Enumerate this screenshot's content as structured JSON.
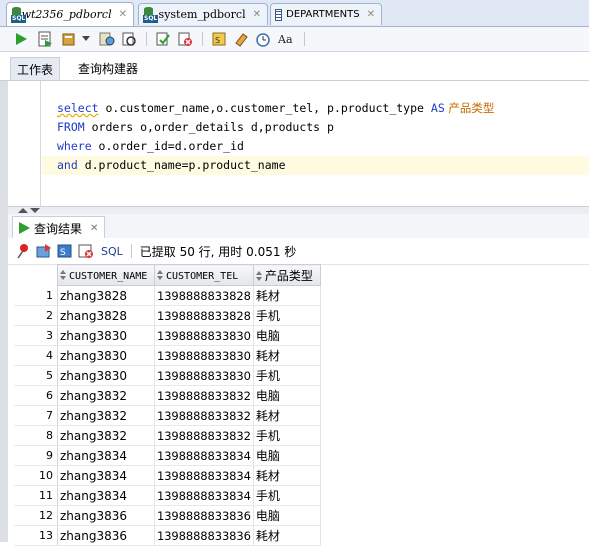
{
  "document_tabs": [
    {
      "label": "wt2356_pdborcl",
      "icon": "sql-worksheet-icon",
      "active": true
    },
    {
      "label": "system_pdborcl",
      "icon": "sql-worksheet-icon",
      "active": false
    },
    {
      "label": "DEPARTMENTS",
      "icon": "table-icon",
      "active": false
    }
  ],
  "subtabs": {
    "worksheet": "工作表",
    "query_builder": "查询构建器"
  },
  "sql": {
    "line1": {
      "kw1": "select",
      "cols": " o.customer_name,o.customer_tel, p.product_type ",
      "kw2": "AS",
      "alias": " 产品类型"
    },
    "line2": {
      "kw1": "FROM",
      "rest": " orders o,order_details d,products p"
    },
    "line3": {
      "kw1": "where",
      "rest": " o.order_id=d.order_id"
    },
    "line4": {
      "kw1": "and",
      "rest": " d.product_name=p.product_name"
    }
  },
  "results": {
    "tab_label": "查询结果",
    "sql_label": "SQL",
    "status": "已提取 50 行, 用时 0.051 秒",
    "columns": [
      "CUSTOMER_NAME",
      "CUSTOMER_TEL",
      "产品类型"
    ],
    "rows": [
      [
        "1",
        "zhang3828",
        "1398888833828",
        "耗材"
      ],
      [
        "2",
        "zhang3828",
        "1398888833828",
        "手机"
      ],
      [
        "3",
        "zhang3830",
        "1398888833830",
        "电脑"
      ],
      [
        "4",
        "zhang3830",
        "1398888833830",
        "耗材"
      ],
      [
        "5",
        "zhang3830",
        "1398888833830",
        "手机"
      ],
      [
        "6",
        "zhang3832",
        "1398888833832",
        "电脑"
      ],
      [
        "7",
        "zhang3832",
        "1398888833832",
        "耗材"
      ],
      [
        "8",
        "zhang3832",
        "1398888833832",
        "手机"
      ],
      [
        "9",
        "zhang3834",
        "1398888833834",
        "电脑"
      ],
      [
        "10",
        "zhang3834",
        "1398888833834",
        "耗材"
      ],
      [
        "11",
        "zhang3834",
        "1398888833834",
        "手机"
      ],
      [
        "12",
        "zhang3836",
        "1398888833836",
        "电脑"
      ],
      [
        "13",
        "zhang3836",
        "1398888833836",
        "耗材"
      ]
    ]
  },
  "colors": {
    "keyword": "#1f3cc8",
    "alias": "#c96b00"
  }
}
